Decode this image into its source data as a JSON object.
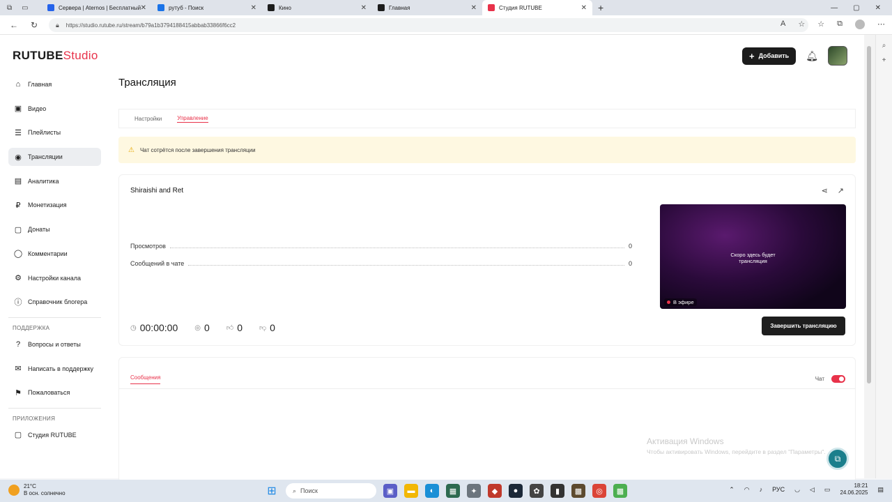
{
  "browser": {
    "tabs": [
      {
        "title": "Сервера | Aternos | Бесплатный",
        "color": "#2563eb"
      },
      {
        "title": "рутуб - Поиск",
        "color": "#1a73e8"
      },
      {
        "title": "Кино",
        "color": "#1c1c1c"
      },
      {
        "title": "Главная",
        "color": "#1c1c1c"
      },
      {
        "title": "Студия RUTUBE",
        "color": "#e8324a"
      }
    ],
    "new_tab": "+",
    "url": "https://studio.rutube.ru/stream/b79a1b3794188415abbab33866f6cc2"
  },
  "header": {
    "logo_main": "RUTUBE",
    "logo_sub": "Studio",
    "add_button": "Добавить"
  },
  "sidebar": {
    "items": [
      {
        "label": "Главная",
        "icon": "home-icon",
        "glyph": "⌂"
      },
      {
        "label": "Видео",
        "icon": "video-icon",
        "glyph": "▣"
      },
      {
        "label": "Плейлисты",
        "icon": "playlist-icon",
        "glyph": "☰"
      },
      {
        "label": "Трансляции",
        "icon": "broadcast-icon",
        "glyph": "◉"
      },
      {
        "label": "Аналитика",
        "icon": "analytics-icon",
        "glyph": "▤"
      },
      {
        "label": "Монетизация",
        "icon": "monetization-icon",
        "glyph": "₽"
      },
      {
        "label": "Донаты",
        "icon": "donate-icon",
        "glyph": "▢"
      },
      {
        "label": "Комментарии",
        "icon": "comments-icon",
        "glyph": "◯"
      },
      {
        "label": "Настройки канала",
        "icon": "settings-icon",
        "glyph": "⚙"
      },
      {
        "label": "Справочник блогера",
        "icon": "info-icon",
        "glyph": "ⓘ"
      }
    ],
    "support_title": "ПОДДЕРЖКА",
    "support_items": [
      {
        "label": "Вопросы и ответы",
        "icon": "help-icon",
        "glyph": "?"
      },
      {
        "label": "Написать в поддержку",
        "icon": "mail-icon",
        "glyph": "✉"
      },
      {
        "label": "Пожаловаться",
        "icon": "flag-icon",
        "glyph": "⚑"
      }
    ],
    "apps_title": "ПРИЛОЖЕНИЯ",
    "apps_items": [
      {
        "label": "Студия RUTUBE",
        "icon": "app-icon",
        "glyph": "▢"
      }
    ]
  },
  "main": {
    "title": "Трансляция",
    "tabs": [
      "Настройки",
      "Управление"
    ],
    "alert": "Чат сотрётся после завершения трансляции",
    "stream": {
      "name": "Shiraishi and Ret",
      "stats": [
        {
          "label": "Просмотров",
          "value": "0"
        },
        {
          "label": "Сообщений в чате",
          "value": "0"
        }
      ],
      "preview_text_1": "Скоро здесь будет",
      "preview_text_2": "трансляция",
      "live_label": "В эфире",
      "end_button": "Завершить трансляцию",
      "duration": "00:00:00",
      "viewers": "0",
      "likes": "0",
      "dislikes": "0"
    },
    "messages_tab": "Сообщения",
    "chat_label": "Чат",
    "chat_enabled": true
  },
  "watermark": {
    "line1": "Активация Windows",
    "line2": "Чтобы активировать Windows, перейдите в раздел \"Параметры\"."
  },
  "taskbar": {
    "temperature": "21°C",
    "weather": "В осн. солнечно",
    "search_placeholder": "Поиск",
    "lang": "РУС",
    "time": "18:21",
    "date": "24.06.2025"
  }
}
